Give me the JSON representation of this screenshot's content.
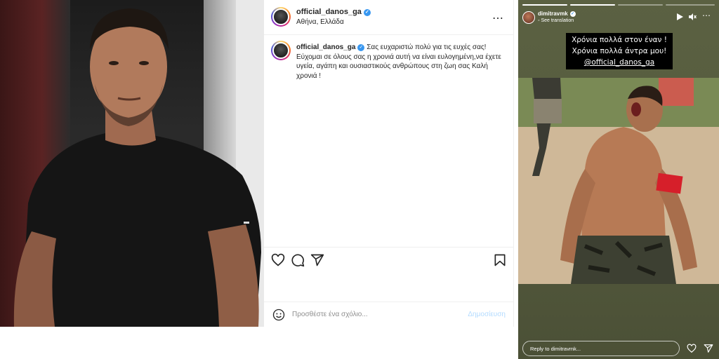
{
  "post": {
    "username": "official_danos_ga",
    "location": "Αθήνα, Ελλάδα",
    "caption_username": "official_danos_ga",
    "caption_text": "Σας ευχαριστώ πολύ για τις ευχές σας! Εύχομαι σε όλους σας η χρονιά αυτή να είναι ευλογημένη,να έχετε υγεία, αγάπη και ουσιαστικούς ανθρώπους στη ζωη σας Καλή χρονιά !",
    "comment_placeholder": "Προσθέστε ένα σχόλιο...",
    "post_button": "Δημοσίευση",
    "more_icon": "⋯"
  },
  "story": {
    "username": "dimitravmk",
    "see_translation": "See translation",
    "caption_lines": [
      "Χρόνια πολλά στον έναν !",
      "Χρόνια πολλά άντρα μου!",
      "@official_danos_ga"
    ],
    "reply_placeholder": "Reply to dimitravmk...",
    "progress": [
      1,
      1,
      0,
      0
    ]
  },
  "colors": {
    "accent": "#3897f0",
    "post_disabled": "#b3dbff"
  }
}
